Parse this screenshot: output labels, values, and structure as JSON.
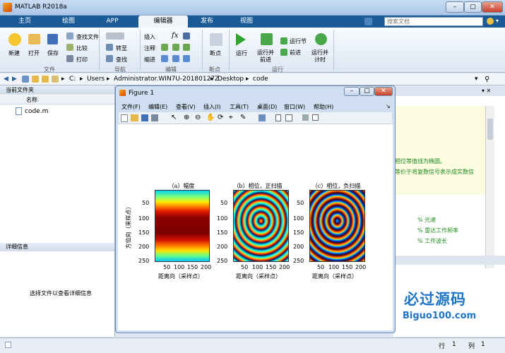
{
  "window": {
    "title": "MATLAB R2018a"
  },
  "tabs": [
    {
      "label": "主页"
    },
    {
      "label": "绘图"
    },
    {
      "label": "APP"
    },
    {
      "label": "编辑器"
    },
    {
      "label": "发布"
    },
    {
      "label": "视图"
    }
  ],
  "search": {
    "placeholder": "搜索文档"
  },
  "ribbon": {
    "file": {
      "new": "新建",
      "open": "打开",
      "save": "保存",
      "find_file": "查找文件",
      "compare": "比较",
      "print": "打印",
      "section": "文件"
    },
    "nav": {
      "goto": "转至",
      "find": "查找",
      "section": "导航"
    },
    "edit": {
      "insert": "插入",
      "fx": "fx",
      "comment": "注释",
      "indent": "缩进",
      "section": "编辑"
    },
    "breakpoints": {
      "label": "断点",
      "section": "断点"
    },
    "run": {
      "run": "运行",
      "run_advance": "运行并\n前进",
      "run_section": "运行节",
      "advance": "前进",
      "run_time": "运行并\n计时",
      "section": "运行"
    }
  },
  "address": {
    "parts": [
      "C:",
      "Users",
      "Administrator.WIN7U-20180127Z",
      "Desktop",
      "code"
    ]
  },
  "file_panel": {
    "title": "当前文件夹",
    "column": "名称",
    "file": "code.m"
  },
  "detail_panel": {
    "title": "详细信息",
    "message": "选择文件以查看详细信息"
  },
  "editor_snippets": {
    "line1": "相位等值线为椭圆。",
    "line2": "等价于将复数信号表示成实数信",
    "c1": "% 光速",
    "c2": "% 雷达工作频率",
    "c3": "% 工作波长"
  },
  "watermark": {
    "text": "必过源码",
    "url": "Biguo100.com"
  },
  "status": {
    "row_label": "行",
    "row": "1",
    "col_label": "列",
    "col": "1"
  },
  "figure": {
    "title": "Figure 1",
    "menu": [
      "文件(F)",
      "编辑(E)",
      "查看(V)",
      "插入(I)",
      "工具(T)",
      "桌面(D)",
      "窗口(W)",
      "帮助(H)"
    ],
    "ylabel": "方位向（采样点）",
    "xlabel": "距离向（采样点）",
    "subplots": [
      {
        "title": "（a）幅度"
      },
      {
        "title": "（b）相位，正扫描"
      },
      {
        "title": "（c）相位，负扫描"
      }
    ],
    "yticks": [
      "50",
      "100",
      "150",
      "200",
      "250"
    ],
    "xticks": [
      "50",
      "100",
      "150",
      "200"
    ]
  },
  "colors": {
    "tab_bar": "#1a5a96",
    "accent": "#f1f5fa",
    "comment": "#228b22"
  }
}
